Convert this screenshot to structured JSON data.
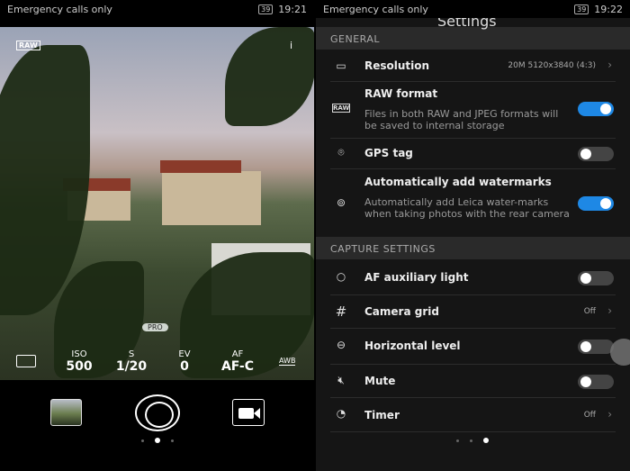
{
  "left": {
    "status": {
      "carrier": "Emergency calls only",
      "battery": "39",
      "time": "19:21"
    },
    "raw_badge": "RAW",
    "info": "i",
    "mode_badge": "PRO",
    "params": [
      {
        "label": "ISO",
        "value": "500"
      },
      {
        "label": "S",
        "value": "1/20"
      },
      {
        "label": "EV",
        "value": "0"
      },
      {
        "label": "AF",
        "value": "AF-C"
      }
    ],
    "awb": "AWB",
    "metering_icon": "metering-icon"
  },
  "right": {
    "status": {
      "carrier": "Emergency calls only",
      "battery": "39",
      "time": "19:22"
    },
    "title": "Settings",
    "general": "GENERAL",
    "resolution": {
      "label": "Resolution",
      "value": "20M 5120x3840 (4:3)"
    },
    "raw": {
      "label": "RAW format",
      "desc": "Files in both RAW and JPEG formats will be saved to internal storage",
      "on": true,
      "icon": "RAW"
    },
    "gps": {
      "label": "GPS tag",
      "on": false
    },
    "watermark": {
      "label": "Automatically add watermarks",
      "desc": "Automatically add Leica water-marks when taking photos with the rear camera",
      "on": true
    },
    "capture": "CAPTURE SETTINGS",
    "af_light": {
      "label": "AF auxiliary light",
      "on": false
    },
    "grid": {
      "label": "Camera grid",
      "value": "Off"
    },
    "level": {
      "label": "Horizontal level",
      "on": false
    },
    "mute": {
      "label": "Mute",
      "on": false
    },
    "timer": {
      "label": "Timer",
      "value": "Off"
    }
  },
  "colors": {
    "accent": "#1e88e5"
  }
}
